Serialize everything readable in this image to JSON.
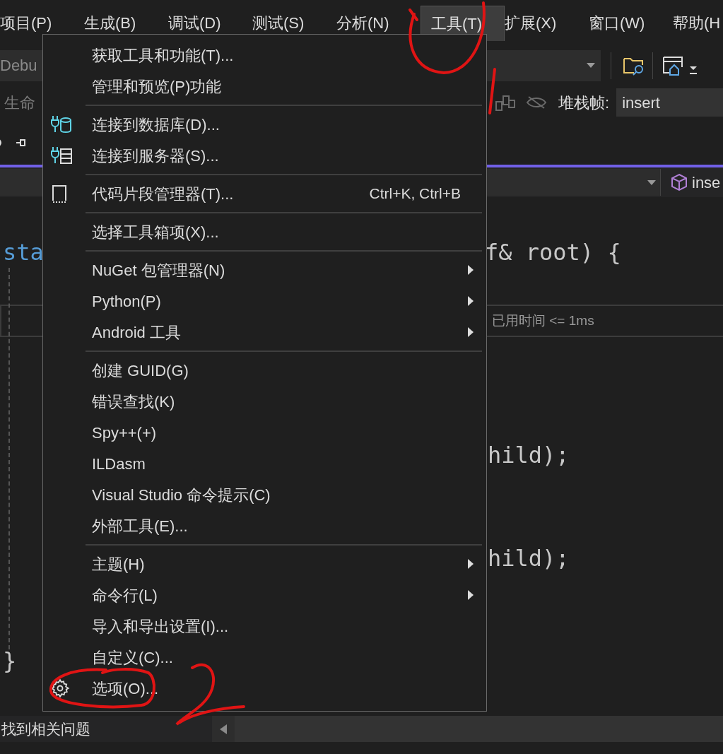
{
  "menu_bar": [
    {
      "label": "项目(P)",
      "selected": false
    },
    {
      "label": "生成(B)",
      "selected": false
    },
    {
      "label": "调试(D)",
      "selected": false
    },
    {
      "label": "测试(S)",
      "selected": false
    },
    {
      "label": "分析(N)",
      "selected": false
    },
    {
      "label": "工具(T)",
      "selected": true
    },
    {
      "label": "扩展(X)",
      "selected": false
    },
    {
      "label": "窗口(W)",
      "selected": false
    },
    {
      "label": "帮助(H",
      "selected": false
    }
  ],
  "toolbar": {
    "config_dropdown": "Debu",
    "lifecycle_label": "生命",
    "stack_frame_label": "堆栈帧:",
    "stack_frame_value": "insert"
  },
  "editor": {
    "member_dropdown": "inse",
    "signature_left": "sta",
    "signature_right": "f& root) {",
    "timing": "已用时间 <= 1ms",
    "call_1": "hild);",
    "call_2": "hild);",
    "closing_brace": "}"
  },
  "status_bar": {
    "message": "找到相关问题"
  },
  "tools_menu": {
    "groups": [
      [
        {
          "label": "获取工具和功能(T)...",
          "submenu": false
        },
        {
          "label": "管理和预览(P)功能",
          "submenu": false
        }
      ],
      [
        {
          "label": "连接到数据库(D)...",
          "kind": "database",
          "submenu": false
        },
        {
          "label": "连接到服务器(S)...",
          "kind": "server",
          "submenu": false
        }
      ],
      [
        {
          "label": "代码片段管理器(T)...",
          "kind": "snippet",
          "shortcut": "Ctrl+K, Ctrl+B",
          "submenu": false
        }
      ],
      [
        {
          "label": "选择工具箱项(X)...",
          "submenu": false
        }
      ],
      [
        {
          "label": "NuGet 包管理器(N)",
          "submenu": true
        },
        {
          "label": "Python(P)",
          "submenu": true
        },
        {
          "label": "Android 工具",
          "submenu": true
        }
      ],
      [
        {
          "label": "创建 GUID(G)",
          "submenu": false
        },
        {
          "label": "错误查找(K)",
          "submenu": false
        },
        {
          "label": "Spy++(+)",
          "submenu": false
        },
        {
          "label": "ILDasm",
          "submenu": false
        },
        {
          "label": "Visual Studio 命令提示(C)",
          "submenu": false
        },
        {
          "label": "外部工具(E)...",
          "submenu": false
        }
      ],
      [
        {
          "label": "主题(H)",
          "submenu": true
        },
        {
          "label": "命令行(L)",
          "submenu": true
        },
        {
          "label": "导入和导出设置(I)...",
          "submenu": false
        },
        {
          "label": "自定义(C)...",
          "submenu": false
        },
        {
          "label": "选项(O)...",
          "kind": "gear",
          "submenu": false
        }
      ]
    ]
  }
}
